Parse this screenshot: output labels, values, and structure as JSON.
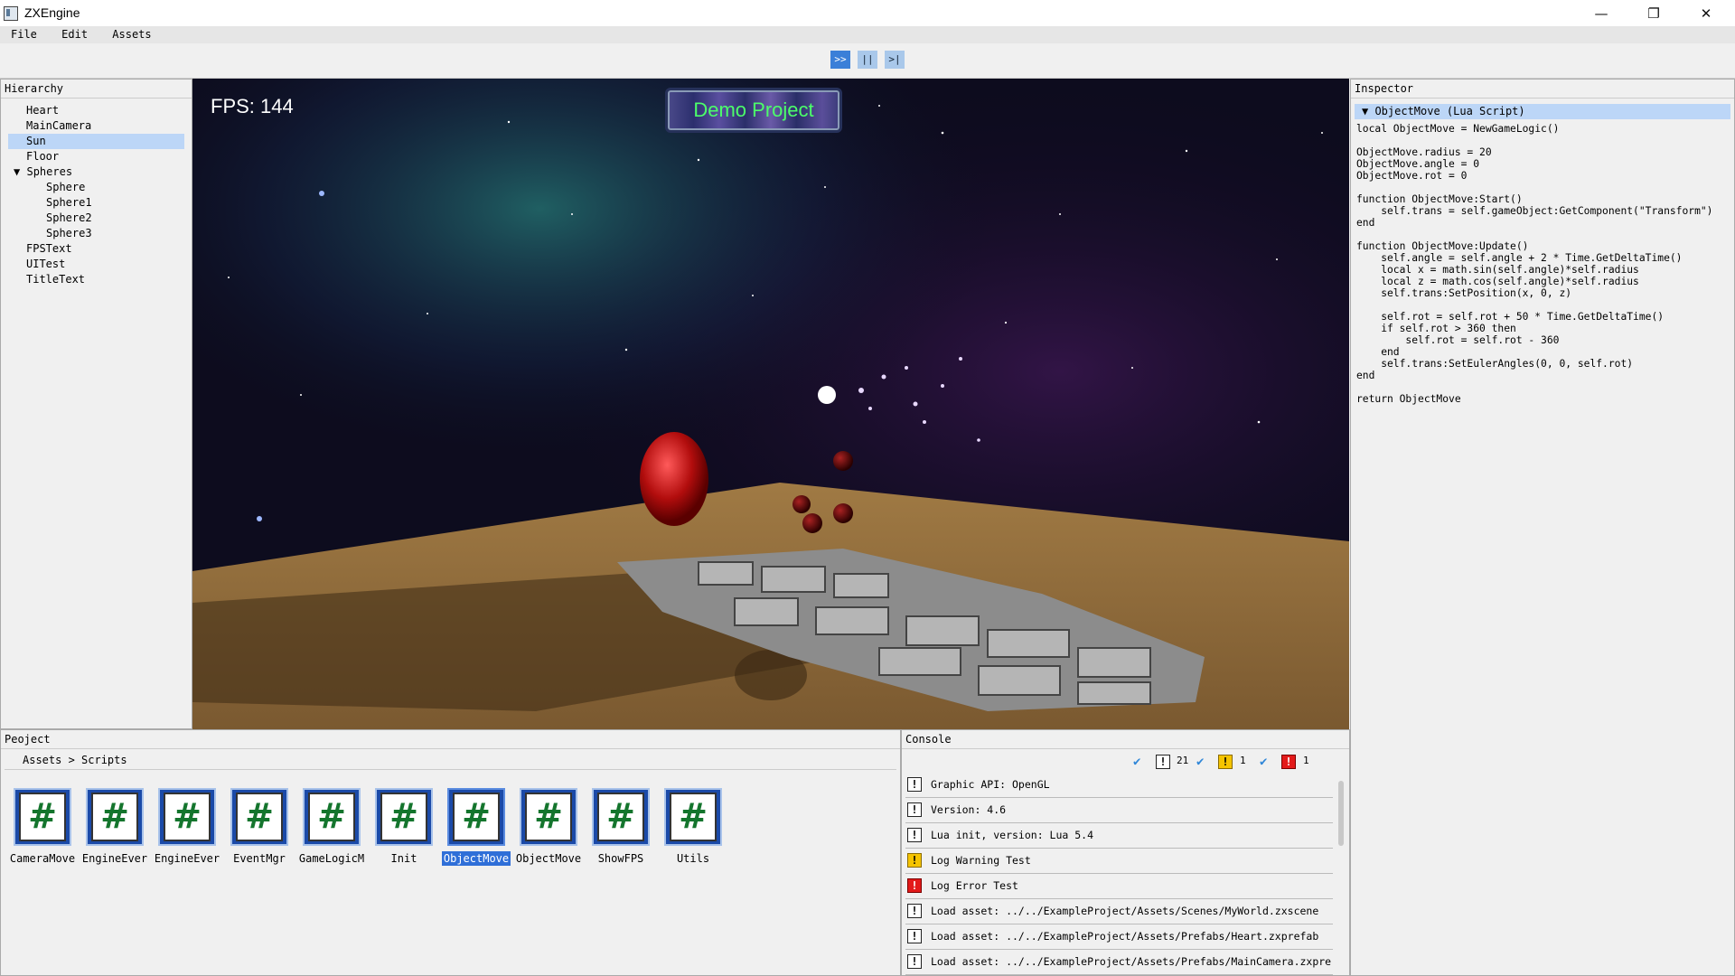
{
  "window": {
    "title": "ZXEngine",
    "minimize": "—",
    "restore": "❐",
    "close": "✕"
  },
  "menu": {
    "file": "File",
    "edit": "Edit",
    "assets": "Assets"
  },
  "toolbar": {
    "play": ">>",
    "pause": "||",
    "step": ">|"
  },
  "hierarchy": {
    "title": "Hierarchy",
    "items": [
      {
        "label": "Heart"
      },
      {
        "label": "MainCamera"
      },
      {
        "label": "Sun"
      },
      {
        "label": "Floor"
      },
      {
        "label": "Spheres",
        "arrow": "▼"
      },
      {
        "label": "Sphere"
      },
      {
        "label": "Sphere1"
      },
      {
        "label": "Sphere2"
      },
      {
        "label": "Sphere3"
      },
      {
        "label": "FPSText"
      },
      {
        "label": "UITest"
      },
      {
        "label": "TitleText"
      }
    ]
  },
  "viewport": {
    "fps": "FPS: 144",
    "title": "Demo Project"
  },
  "inspector": {
    "title": "Inspector",
    "component": "▼  ObjectMove (Lua Script)",
    "code": "local ObjectMove = NewGameLogic()\n\nObjectMove.radius = 20\nObjectMove.angle = 0\nObjectMove.rot = 0\n\nfunction ObjectMove:Start()\n    self.trans = self.gameObject:GetComponent(\"Transform\")\nend\n\nfunction ObjectMove:Update()\n    self.angle = self.angle + 2 * Time.GetDeltaTime()\n    local x = math.sin(self.angle)*self.radius\n    local z = math.cos(self.angle)*self.radius\n    self.trans:SetPosition(x, 0, z)\n\n    self.rot = self.rot + 50 * Time.GetDeltaTime()\n    if self.rot > 360 then\n        self.rot = self.rot - 360\n    end\n    self.trans:SetEulerAngles(0, 0, self.rot)\nend\n\nreturn ObjectMove"
  },
  "project": {
    "title": "Peoject",
    "breadcrumb": "Assets  >  Scripts",
    "files": [
      {
        "name": "CameraMove"
      },
      {
        "name": "EngineEver"
      },
      {
        "name": "EngineEver"
      },
      {
        "name": "EventMgr"
      },
      {
        "name": "GameLogicM"
      },
      {
        "name": "Init"
      },
      {
        "name": "ObjectMove"
      },
      {
        "name": "ObjectMove"
      },
      {
        "name": "ShowFPS"
      },
      {
        "name": "Utils"
      }
    ],
    "file_glyph": "#"
  },
  "console": {
    "title": "Console",
    "info_count": "21",
    "warn_count": "1",
    "error_count": "1",
    "logs": [
      {
        "type": "info",
        "text": "Graphic API: OpenGL"
      },
      {
        "type": "info",
        "text": "Version: 4.6"
      },
      {
        "type": "info",
        "text": "Lua init, version: Lua 5.4"
      },
      {
        "type": "warn",
        "text": "Log Warning Test"
      },
      {
        "type": "err",
        "text": "Log Error Test"
      },
      {
        "type": "info",
        "text": "Load asset: ../../ExampleProject/Assets/Scenes/MyWorld.zxscene"
      },
      {
        "type": "info",
        "text": "Load asset: ../../ExampleProject/Assets/Prefabs/Heart.zxprefab"
      },
      {
        "type": "info",
        "text": "Load asset: ../../ExampleProject/Assets/Prefabs/MainCamera.zxpre"
      }
    ]
  },
  "colors": {
    "accent": "#3b7fd8",
    "selection": "#bcd6f7",
    "hash_green": "#14752d"
  }
}
